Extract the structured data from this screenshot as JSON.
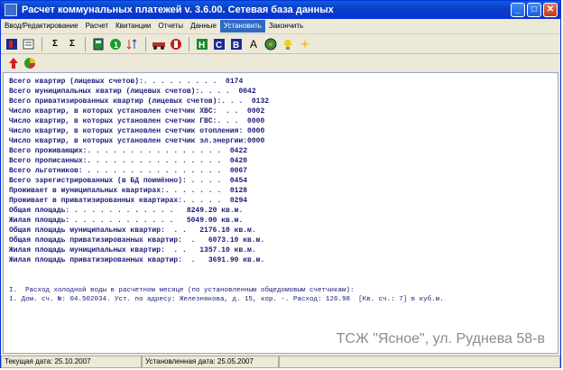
{
  "window": {
    "title": "Расчет коммунальных платежей v. 3.6.00. Сетевая база данных"
  },
  "menu": [
    {
      "label": "Ввод/Редактирование",
      "active": false
    },
    {
      "label": "Расчет",
      "active": false
    },
    {
      "label": "Квитанции",
      "active": false
    },
    {
      "label": "Отчеты",
      "active": false
    },
    {
      "label": "Данные",
      "active": false
    },
    {
      "label": "Установить",
      "active": true
    },
    {
      "label": "Закончить",
      "active": false
    }
  ],
  "toolbar_icons": [
    "exit-icon",
    "edit-icon",
    "sum-icon",
    "sum-alt-icon",
    "calculator-icon",
    "number-one-icon",
    "sort-icon",
    "car-icon",
    "fire-icon",
    "green-h-icon",
    "blue-c-icon",
    "blue-b-icon",
    "font-a-icon",
    "globe-icon",
    "bulb-icon",
    "sparkle-icon"
  ],
  "report_lines": [
    "Всего квартир (лицевых счетов):. . . . . . . . .  0174",
    "Всего муниципальных кватир (лицевых счетов):. . . .  0042",
    "Всего приватизированных квартир (лицевых счетов):. . .  0132",
    "Число квартир, в которых установлен счетчик ХВС:  . .  0002",
    "Число квартир, в которых установлен счетчик ГВС:. . .  0000",
    "Число квартир, в которых установлен счетчик отопления: 0000",
    "Число квартир, в которых установлен счетчик эл.энергии:0000",
    "Всего проживающих:. . . . . . . . . . . . . . . .  0422",
    "Всего прописанных:. . . . . . . . . . . . . . . .  0420",
    "Всего льготников: . . . . . . . . . . . . . . . .  0067",
    "Всего зарегистрированных (в БД поимённо): . . . .  0454",
    "Проживает в муниципальных квартирах:. . . . . . .  0128",
    "Проживает в приватизированных квартирах:. . . . .  0294",
    "Общая площадь: . . . . . . . . . . . .   8249.20 кв.м.",
    "Жилая площадь: . . . . . . . . . . . .   5049.00 кв.м.",
    "Общая площадь муниципальных квартир:  . .   2176.10 кв.м.",
    "Общая площадь приватизированных квартир:  .   6073.10 кв.м.",
    "Жилая площадь муниципальных квартир:  . .   1357.10 кв.м.",
    "Жилая площадь приватизированных квартир:  .   3691.90 кв.м."
  ],
  "water": {
    "line1": "I.  Расход холодной воды в расчетном месяце (по установленным общедомовым счетчикам):",
    "line2": "1. Дом. сч. №: 04.502034. Уст. по адресу: Железнякова, д. 15, кор. -. Расход: 126.98  [Кв. сч.: 7] в куб.м."
  },
  "watermark": "ТСЖ \"Ясное\",  ул. Руднева 58-в",
  "status": {
    "current_date": "Текущая дата: 25.10.2007",
    "set_date": "Установленная дата: 25.05.2007"
  },
  "colors": {
    "titlebar": "#0831d9",
    "report_text": "#1a1a7a",
    "menu_active": "#316ac5"
  }
}
